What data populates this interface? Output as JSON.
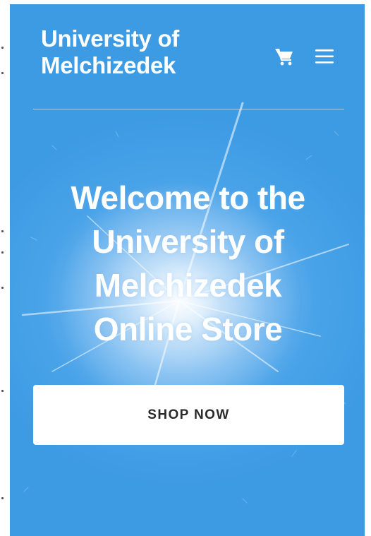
{
  "header": {
    "logo_line1": "University of",
    "logo_line2": "Melchizedek",
    "cart_icon": "cart-icon",
    "menu_icon": "hamburger-menu-icon"
  },
  "hero": {
    "title": "Welcome to the University of Melchizedek Online Store",
    "cta_label": "SHOP NOW"
  },
  "colors": {
    "background": "#3d9be4",
    "text": "#ffffff",
    "button_bg": "#ffffff",
    "button_text": "#2a2a2a"
  }
}
